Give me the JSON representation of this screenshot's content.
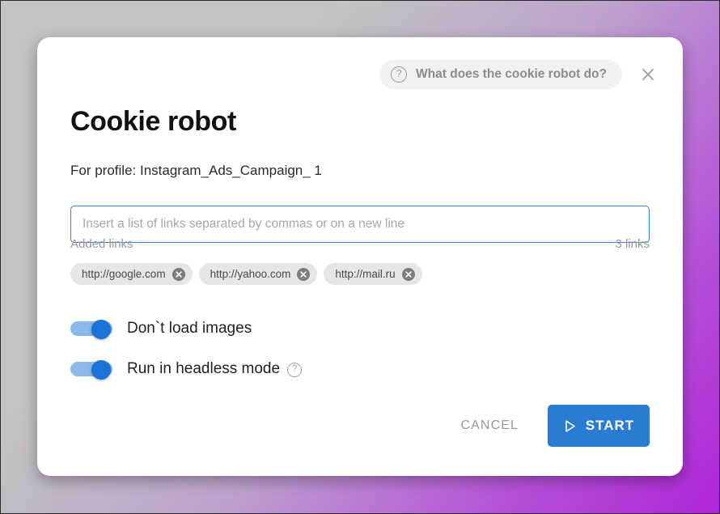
{
  "dialog": {
    "title": "Cookie robot",
    "profile_line": "For profile: Instagram_Ads_Campaign_ 1",
    "help_pill_label": "What does the cookie robot do?",
    "help_icon": "question-circle-icon",
    "close_icon": "close-icon"
  },
  "input": {
    "placeholder": "Insert a list of links separated by commas or on a new line",
    "value": "",
    "border_color": "#3b82d6"
  },
  "links": {
    "label": "Added links",
    "count_label": "3 links",
    "items": [
      {
        "url": "http://google.com",
        "remove_icon": "close-circle-icon"
      },
      {
        "url": "http://yahoo.com",
        "remove_icon": "close-circle-icon"
      },
      {
        "url": "http://mail.ru",
        "remove_icon": "close-circle-icon"
      }
    ]
  },
  "toggles": [
    {
      "label": "Don`t load images",
      "checked": true,
      "has_help": false
    },
    {
      "label": "Run in headless mode",
      "checked": true,
      "has_help": true,
      "help_icon": "question-circle-icon"
    }
  ],
  "footer": {
    "cancel_label": "CANCEL",
    "start_label": "START",
    "start_icon": "play-icon",
    "start_color": "#2a7bd4"
  },
  "theme": {
    "accent": "#1a73d6",
    "toggle_track": "#8db9e8",
    "chip_bg": "#e6e6e6",
    "muted_text": "#9a9a9a",
    "background_from": "#c3c3c3",
    "background_to": "#ae25d6"
  }
}
